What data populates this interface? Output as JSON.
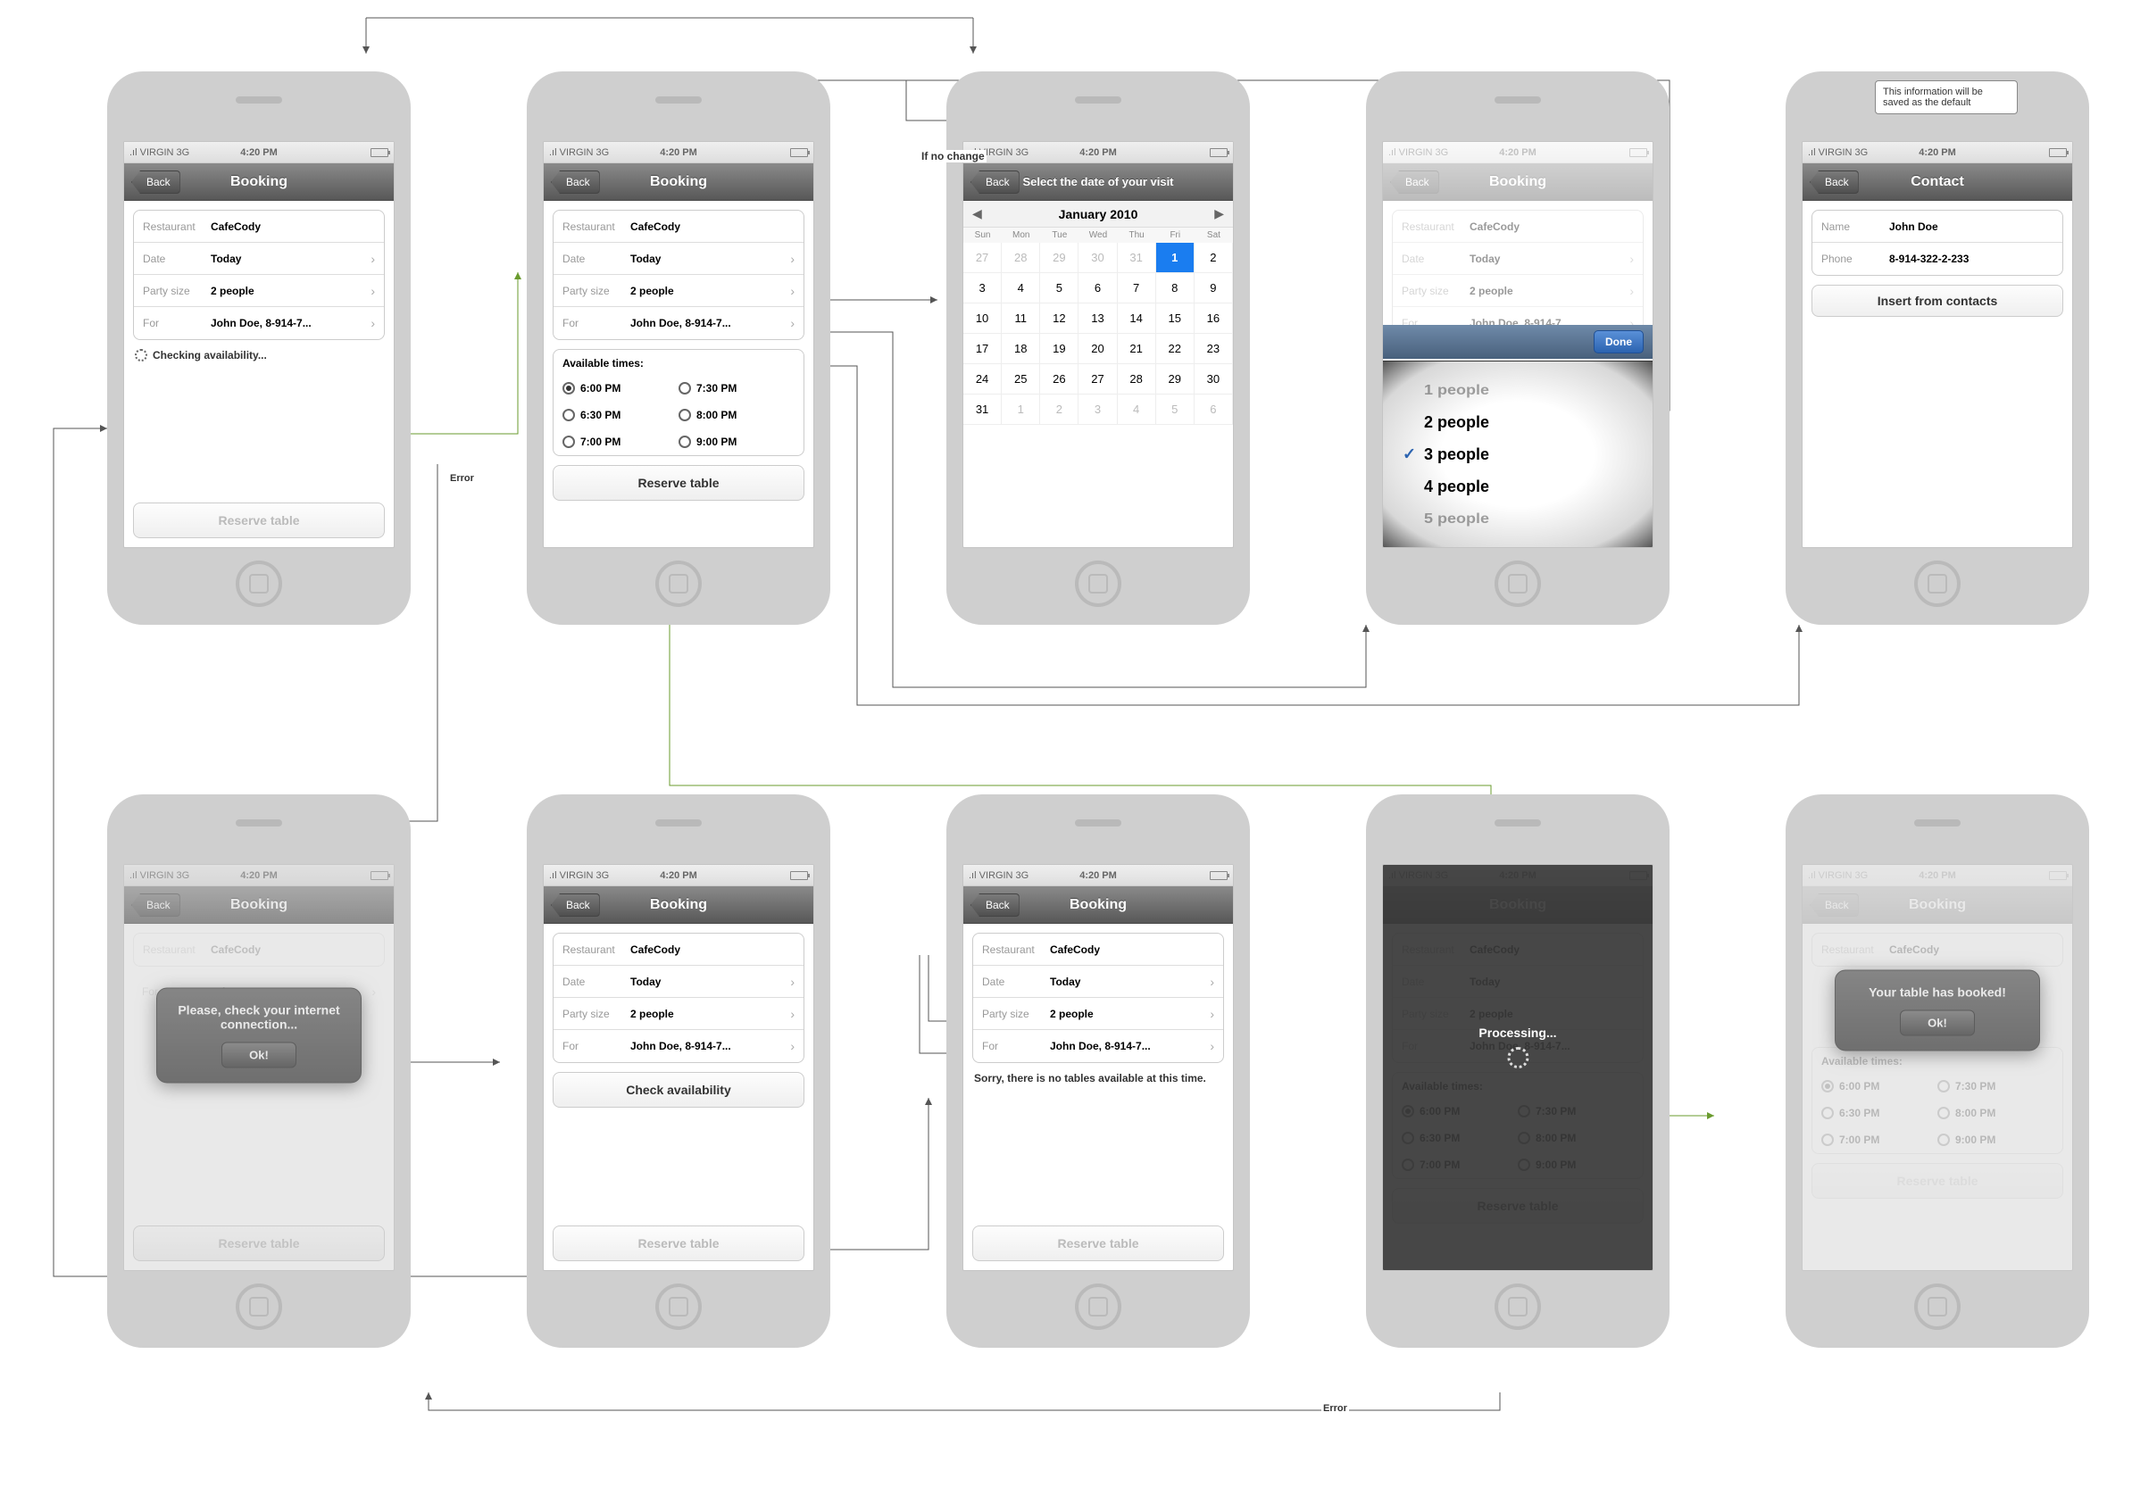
{
  "status": {
    "carrier": ".ıl VIRGIN  3G",
    "time": "4:20 PM"
  },
  "nav": {
    "back": "Back",
    "booking": "Booking",
    "calendar": "Select the date of your visit",
    "contact": "Contact"
  },
  "form": {
    "restaurant_lbl": "Restaurant",
    "restaurant_val": "CafeCody",
    "date_lbl": "Date",
    "date_val": "Today",
    "party_lbl": "Party size",
    "party_val": "2 people",
    "for_lbl": "For",
    "for_val": "John Doe, 8-914-7..."
  },
  "contact": {
    "name_lbl": "Name",
    "name_val": "John Doe",
    "phone_lbl": "Phone",
    "phone_val": "8-914-322-2-233",
    "insert": "Insert from contacts"
  },
  "buttons": {
    "reserve": "Reserve table",
    "check": "Check availability",
    "ok": "Ok!",
    "done": "Done"
  },
  "status_text": {
    "checking": "Checking availability...",
    "notables": "Sorry, there is no tables available at this time.",
    "processing": "Processing..."
  },
  "available": {
    "title": "Available times:",
    "times": [
      "6:00 PM",
      "7:30 PM",
      "6:30 PM",
      "8:00 PM",
      "7:00 PM",
      "9:00 PM"
    ]
  },
  "calendar": {
    "month": "January 2010",
    "days": [
      "Sun",
      "Mon",
      "Tue",
      "Wed",
      "Thu",
      "Fri",
      "Sat"
    ],
    "leading": [
      "27",
      "28",
      "29",
      "30",
      "31"
    ],
    "cells": [
      "1",
      "2",
      "3",
      "4",
      "5",
      "6",
      "7",
      "8",
      "9",
      "10",
      "11",
      "12",
      "13",
      "14",
      "15",
      "16",
      "17",
      "18",
      "19",
      "20",
      "21",
      "22",
      "23",
      "24",
      "25",
      "26",
      "27",
      "28",
      "29",
      "30",
      "31"
    ],
    "trailing": [
      "1",
      "2",
      "3",
      "4",
      "5",
      "6"
    ],
    "selected": "1"
  },
  "picker": [
    "1 people",
    "2 people",
    "3 people",
    "4 people",
    "5 people"
  ],
  "modals": {
    "connection": "Please, check your internet connection...",
    "booked": "Your table has booked!"
  },
  "tooltip": "This information will be saved as the default",
  "annot": {
    "nochange": "If no change",
    "error": "Error"
  }
}
